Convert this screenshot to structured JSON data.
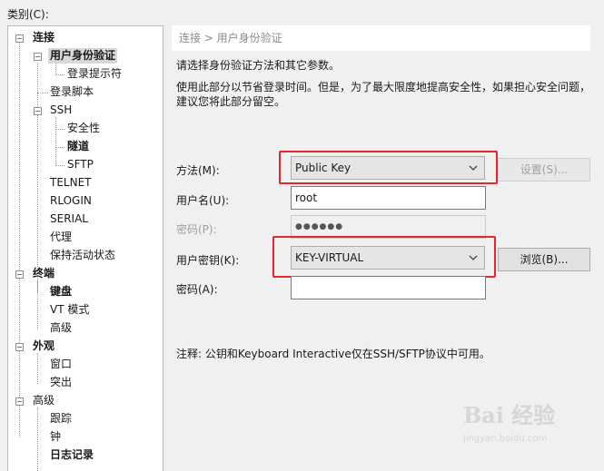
{
  "category_label": "类别(C):",
  "tree": {
    "items": [
      {
        "label": "连接"
      },
      {
        "label": "用户身份验证"
      },
      {
        "label": "登录提示符"
      },
      {
        "label": "登录脚本"
      },
      {
        "label": "SSH"
      },
      {
        "label": "安全性"
      },
      {
        "label": "隧道"
      },
      {
        "label": "SFTP"
      },
      {
        "label": "TELNET"
      },
      {
        "label": "RLOGIN"
      },
      {
        "label": "SERIAL"
      },
      {
        "label": "代理"
      },
      {
        "label": "保持活动状态"
      },
      {
        "label": "终端"
      },
      {
        "label": "键盘"
      },
      {
        "label": "VT 模式"
      },
      {
        "label": "高级"
      },
      {
        "label": "外观"
      },
      {
        "label": "窗口"
      },
      {
        "label": "突出"
      },
      {
        "label": "高级"
      },
      {
        "label": "跟踪"
      },
      {
        "label": "钟"
      },
      {
        "label": "日志记录"
      }
    ]
  },
  "breadcrumb": "连接 > 用户身份验证",
  "description": {
    "line1": "请选择身份验证方法和其它参数。",
    "line2": "使用此部分以节省登录时间。但是，为了最大限度地提高安全性，如果担心安全问题，",
    "line3": "建议您将此部分留空。"
  },
  "form": {
    "method_label": "方法(M):",
    "method_value": "Public Key",
    "settings_button": "设置(S)...",
    "username_label": "用户名(U):",
    "username_value": "root",
    "password_label": "密码(P):",
    "password_value": "●●●●●●",
    "user_key_label": "用户密钥(K):",
    "user_key_value": "KEY-VIRTUAL",
    "browse_button": "浏览(B)...",
    "passphrase_label": "密码(A):",
    "passphrase_value": ""
  },
  "note": "注释: 公钥和Keyboard Interactive仅在SSH/SFTP协议中可用。",
  "watermark": {
    "logo": "Bai 经验",
    "url": "jingyan.baidu.com"
  },
  "colors": {
    "highlight_border": "#e3262f",
    "selected_tree_bg": "#d9d9d9"
  }
}
